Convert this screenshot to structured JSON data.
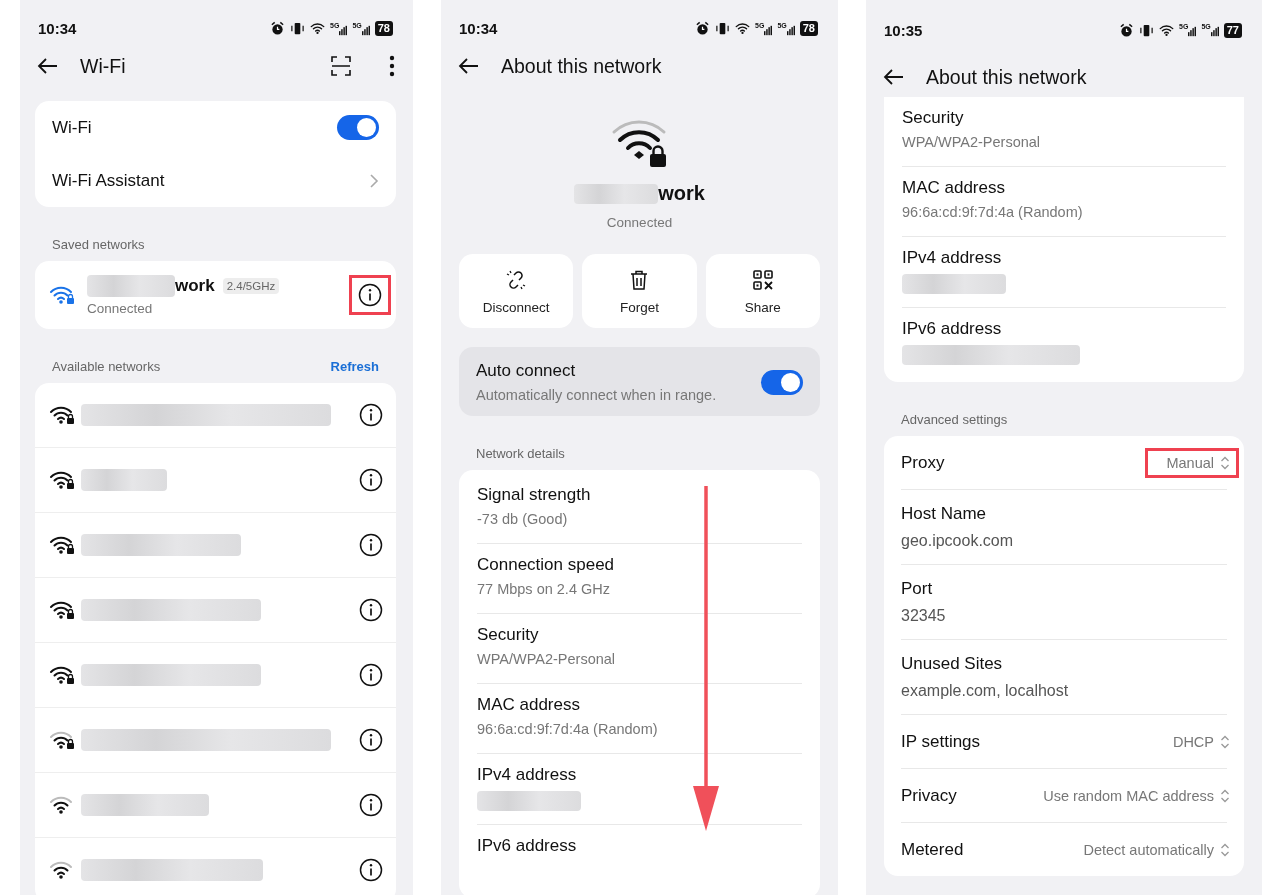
{
  "wifi_screen": {
    "status": {
      "time": "10:34",
      "signals": [
        "5G",
        "5G"
      ],
      "battery": "78"
    },
    "title": "Wi-Fi",
    "settings": [
      {
        "label": "Wi-Fi",
        "kind": "switch",
        "on": true
      },
      {
        "label": "Wi-Fi Assistant",
        "kind": "link"
      }
    ],
    "saved_label": "Saved networks",
    "saved": {
      "name": "work",
      "name_redacted": true,
      "band": "2.4/5GHz",
      "state": "Connected",
      "highlighted": true
    },
    "available_label": "Available networks",
    "refresh": "Refresh",
    "available": [
      {
        "secured": true
      },
      {
        "secured": true
      },
      {
        "secured": true
      },
      {
        "secured": true
      },
      {
        "secured": true
      },
      {
        "secured": true
      },
      {
        "secured": false
      },
      {
        "secured": false
      }
    ]
  },
  "network_screen": {
    "status": {
      "time": "10:34",
      "signals": [
        "5G",
        "5G"
      ],
      "battery": "78"
    },
    "title": "About this network",
    "name": "work",
    "name_redacted": true,
    "state": "Connected",
    "actions": [
      {
        "label": "Disconnect",
        "kind": "unlink"
      },
      {
        "label": "Forget",
        "kind": "trash"
      },
      {
        "label": "Share",
        "kind": "qr"
      }
    ],
    "auto_connect": {
      "label": "Auto connect",
      "description": "Automatically connect when in range.",
      "on": true
    },
    "details_label": "Network details",
    "details": [
      {
        "label": "Signal strength",
        "value": "-73 db (Good)"
      },
      {
        "label": "Connection speed",
        "value": "77 Mbps on 2.4 GHz"
      },
      {
        "label": "Security",
        "value": "WPA/WPA2-Personal"
      },
      {
        "label": "MAC address",
        "value": "96:6a:cd:9f:7d:4a (Random)"
      },
      {
        "label": "IPv4 address",
        "redacted": true
      },
      {
        "label": "IPv6 address"
      }
    ]
  },
  "details_screen": {
    "status": {
      "time": "10:35",
      "signals": [
        "5G",
        "5G"
      ],
      "battery": "77"
    },
    "title": "About this network",
    "info": [
      {
        "label": "Security",
        "value": "WPA/WPA2-Personal"
      },
      {
        "label": "MAC address",
        "value": "96:6a:cd:9f:7d:4a (Random)"
      },
      {
        "label": "IPv4 address",
        "redacted": true
      },
      {
        "label": "IPv6 address",
        "redacted": true
      }
    ],
    "advanced_label": "Advanced settings",
    "advanced": [
      {
        "label": "Proxy",
        "kind": "select",
        "value": "Manual",
        "highlighted": true
      },
      {
        "label": "Host Name",
        "kind": "text",
        "value": "geo.ipcook.com"
      },
      {
        "label": "Port",
        "kind": "text",
        "value": "32345"
      },
      {
        "label": "Unused Sites",
        "kind": "text",
        "value": "example.com, localhost"
      },
      {
        "label": "IP settings",
        "kind": "select",
        "value": "DHCP",
        "highlighted": false
      },
      {
        "label": "Privacy",
        "kind": "select",
        "value": "Use random MAC address",
        "highlighted": false
      },
      {
        "label": "Metered",
        "kind": "select",
        "value": "Detect automatically",
        "highlighted": false
      }
    ]
  }
}
